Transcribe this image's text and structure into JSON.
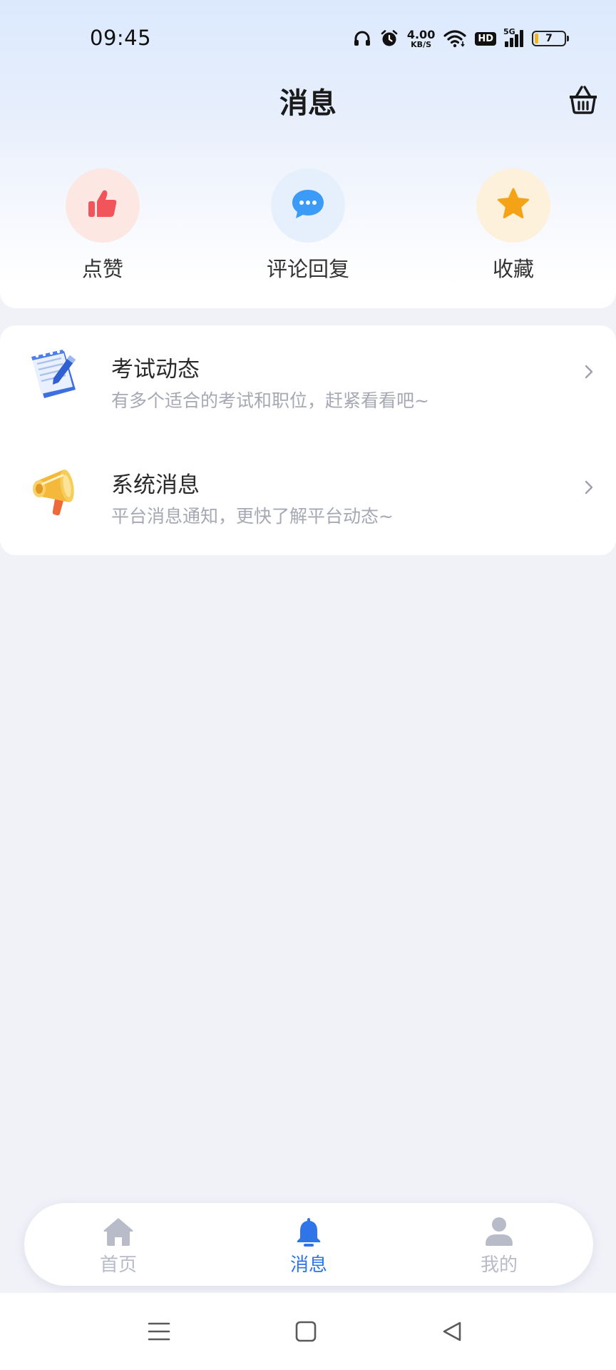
{
  "status_bar": {
    "time": "09:45",
    "net_speed_value": "4.00",
    "net_speed_unit": "KB/S",
    "hd_label": "HD",
    "network_type": "5G",
    "battery_level": "7",
    "icons": [
      "headphones-icon",
      "alarm-icon",
      "wifi-icon",
      "hd-icon",
      "signal-icon",
      "battery-icon"
    ]
  },
  "header": {
    "title": "消息",
    "right_icon": "basket-icon"
  },
  "quick_actions": [
    {
      "label": "点赞",
      "icon": "thumbs-up-icon",
      "bg_color": "#fde7e3",
      "icon_color": "#f2545b"
    },
    {
      "label": "评论回复",
      "icon": "comment-icon",
      "bg_color": "#e6f0fd",
      "icon_color": "#3b9bf6"
    },
    {
      "label": "收藏",
      "icon": "star-icon",
      "bg_color": "#fef1dc",
      "icon_color": "#f5a316"
    }
  ],
  "messages": [
    {
      "title": "考试动态",
      "subtitle": "有多个适合的考试和职位，赶紧看看吧~",
      "icon": "notepad-icon"
    },
    {
      "title": "系统消息",
      "subtitle": "平台消息通知，更快了解平台动态~",
      "icon": "megaphone-icon"
    }
  ],
  "tab_bar": {
    "tabs": [
      {
        "label": "首页",
        "icon": "home-icon",
        "active": false
      },
      {
        "label": "消息",
        "icon": "bell-icon",
        "active": true
      },
      {
        "label": "我的",
        "icon": "user-icon",
        "active": false
      }
    ],
    "active_color": "#2f74e8",
    "inactive_color": "#b8bbc8"
  },
  "system_nav": {
    "buttons": [
      "menu-icon",
      "home-square-icon",
      "back-triangle-icon"
    ]
  }
}
